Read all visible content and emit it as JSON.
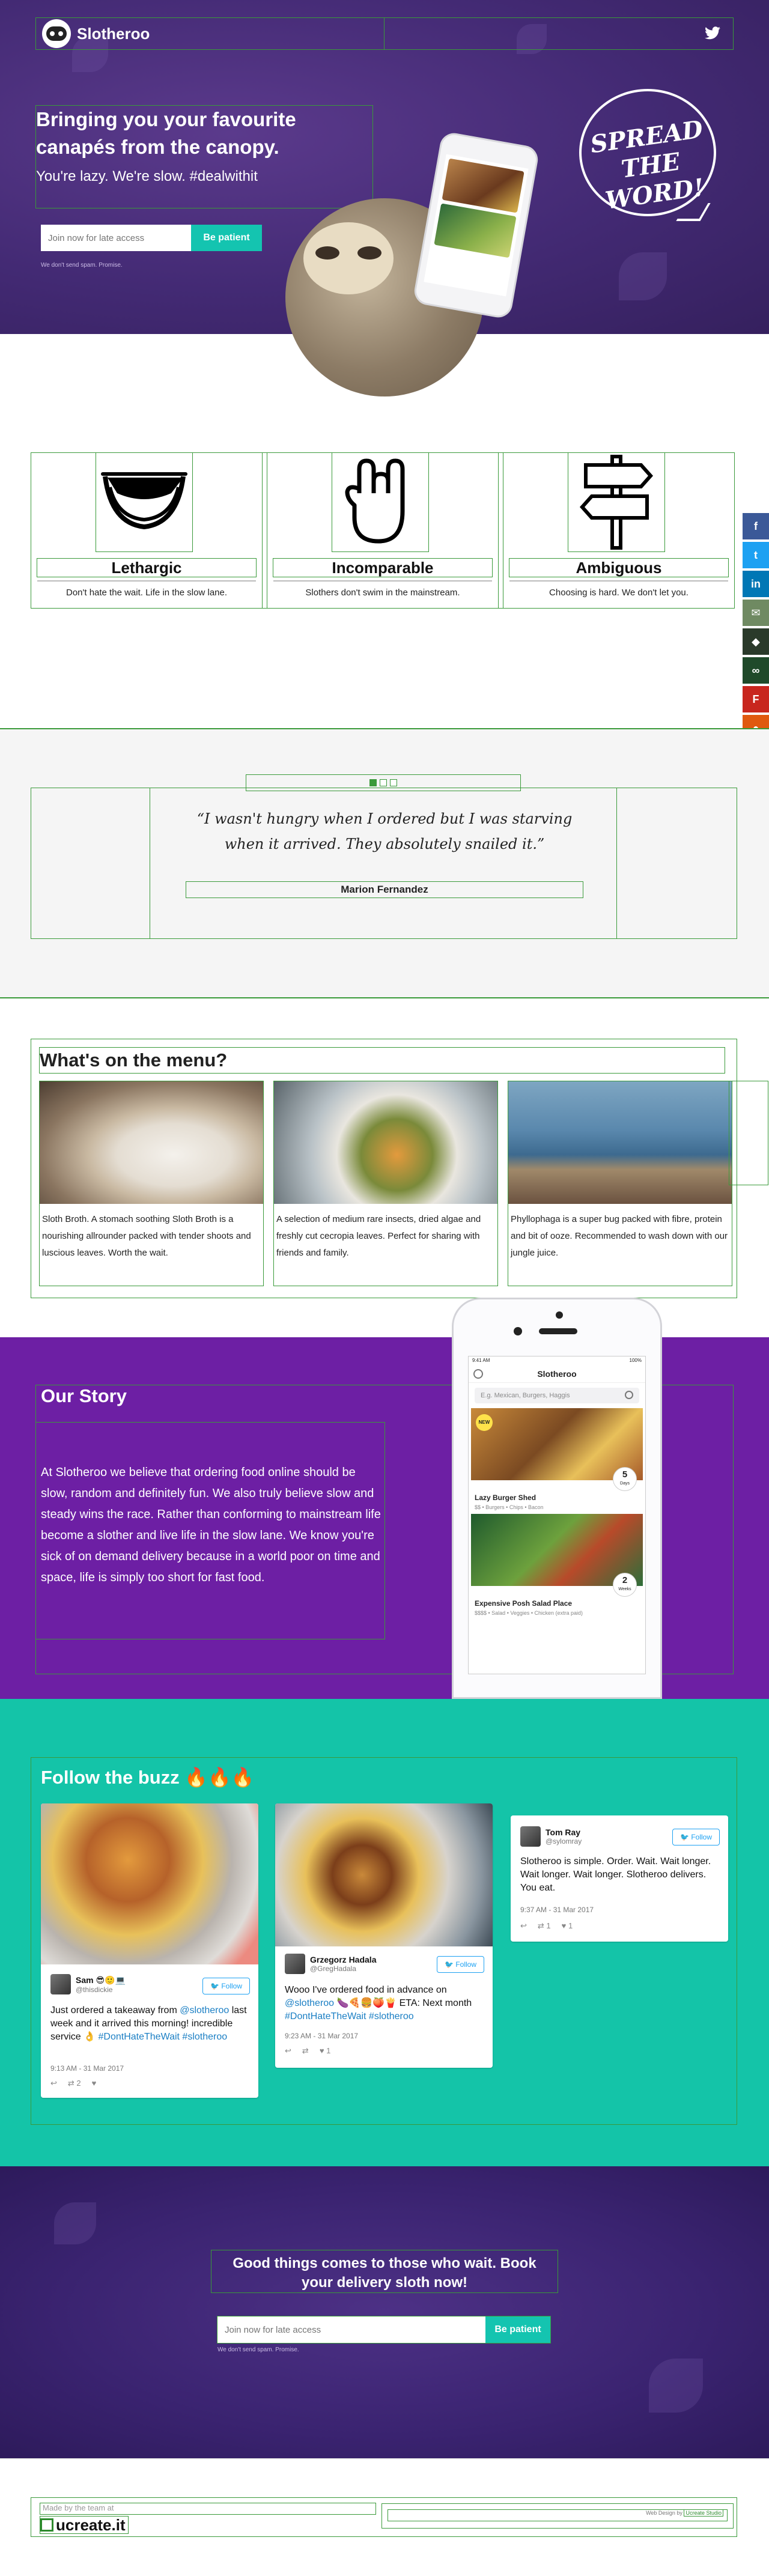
{
  "brand": {
    "name": "Slotheroo"
  },
  "hero": {
    "title": "Bringing you your favourite canapés from the canopy.",
    "subtitle": "You're lazy. We're slow. #dealwithit",
    "email_placeholder": "Join now for late access",
    "button": "Be patient",
    "nospam": "We don't send spam. Promise.",
    "stamp_line1": "SPREAD",
    "stamp_line2": "THE WORD!"
  },
  "features": [
    {
      "title": "Lethargic",
      "text": "Don't hate the wait. Life in the slow lane.",
      "icon": "hammock-icon"
    },
    {
      "title": "Incomparable",
      "text": "Slothers don't swim in the mainstream.",
      "icon": "rock-hand-icon"
    },
    {
      "title": "Ambiguous",
      "text": "Choosing is hard. We don't let you.",
      "icon": "signpost-icon"
    }
  ],
  "social": [
    {
      "icon": "facebook-icon",
      "glyph": "f",
      "color": "#3b5998"
    },
    {
      "icon": "twitter-icon",
      "glyph": "t",
      "color": "#1da1f2"
    },
    {
      "icon": "linkedin-icon",
      "glyph": "in",
      "color": "#0077b5"
    },
    {
      "icon": "email-icon",
      "glyph": "✉",
      "color": "#6f8a62"
    },
    {
      "icon": "car-icon",
      "glyph": "◆",
      "color": "#2a3a2a"
    },
    {
      "icon": "tripadvisor-icon",
      "glyph": "∞",
      "color": "#1f4a2a"
    },
    {
      "icon": "flipboard-icon",
      "glyph": "F",
      "color": "#c8261e"
    },
    {
      "icon": "reddit-icon",
      "glyph": "●",
      "color": "#e0590f"
    },
    {
      "icon": "whatsapp-icon",
      "glyph": "☏",
      "color": "#2ab540"
    }
  ],
  "testimonial": {
    "quote": "“I wasn't hungry when I ordered but I was starving when it arrived. They absolutely snailed it.”",
    "name": "Marion Fernandez"
  },
  "menu": {
    "title": "What's on the menu?",
    "dishes": [
      {
        "desc": "Sloth Broth. A stomach soothing Sloth Broth is a nourishing allrounder packed with tender shoots and luscious leaves. Worth the wait."
      },
      {
        "desc": "A selection of medium rare insects, dried algae and freshly cut cecropia leaves. Perfect for sharing with friends and family."
      },
      {
        "desc": "Phyllophaga is a super bug packed with fibre, protein and bit of ooze. Recommended to wash down with our jungle juice."
      }
    ]
  },
  "story": {
    "title": "Our Story",
    "text": "At Slotheroo we believe that ordering food online should be slow, random and definitely fun. We also truly believe slow and steady wins the race. Rather than conforming to mainstream life become a slother and live life in the slow lane. We know you're sick of on demand delivery because in a world poor on time and space, life is simply too short for fast food."
  },
  "phone": {
    "time": "9:41 AM",
    "battery": "100%",
    "title": "Slotheroo",
    "search_placeholder": "E.g. Mexican, Burgers, Haggis",
    "cards": [
      {
        "name": "Lazy Burger Shed",
        "meta": "$$ • Burgers • Chips • Bacon",
        "days": "5",
        "unit": "Days",
        "badge": "NEW"
      },
      {
        "name": "Expensive Posh Salad Place",
        "meta": "$$$$ • Salad • Veggies • Chicken (extra paid)",
        "days": "2",
        "unit": "Weeks",
        "badge": ""
      }
    ]
  },
  "buzz": {
    "title": "Follow the buzz 🔥🔥🔥",
    "follow_label": "Follow",
    "tweets": [
      {
        "name": "Sam 😎🙂💻",
        "handle": "@thisdickie",
        "pre": "Just ordered a takeaway from ",
        "mention": "@slotheroo",
        "mid": " last week and it arrived this morning! incredible service 👌 ",
        "tag": "#DontHateTheWait #slotheroo",
        "date": "9:13 AM - 31 Mar 2017",
        "retweets": "2",
        "likes": ""
      },
      {
        "name": "Grzegorz Hadala",
        "handle": "@GregHadala",
        "pre": "Wooo I've ordered food in advance on ",
        "mention": "@slotheroo",
        "mid": " 🍆🍕🍔🍑🍟 ETA: Next month ",
        "tag": "#DontHateTheWait #slotheroo",
        "date": "9:23 AM - 31 Mar 2017",
        "retweets": "",
        "likes": "1"
      },
      {
        "name": "Tom Ray",
        "handle": "@sylomray",
        "pre": "Slotheroo is simple. Order. Wait. Wait longer. Wait longer. Wait longer. Slotheroo delivers. You eat.",
        "mention": "",
        "mid": "",
        "tag": "",
        "date": "9:37 AM - 31 Mar 2017",
        "retweets": "1",
        "likes": "1"
      }
    ]
  },
  "cta": {
    "title": "Good things comes to those who wait. Book your delivery sloth now!",
    "email_placeholder": "Join now for late access",
    "button": "Be patient",
    "nospam": "We don't send spam. Promise."
  },
  "footer": {
    "made_by": "Made by the team at",
    "logo": "ucreate.it",
    "right_text": "Web Design by",
    "right_link": "Ucreate Studio"
  },
  "colors": {
    "hero_purple": "#432a74",
    "story_purple": "#6d1fa4",
    "teal": "#14c4a8",
    "accent_button": "#14c4b0"
  }
}
